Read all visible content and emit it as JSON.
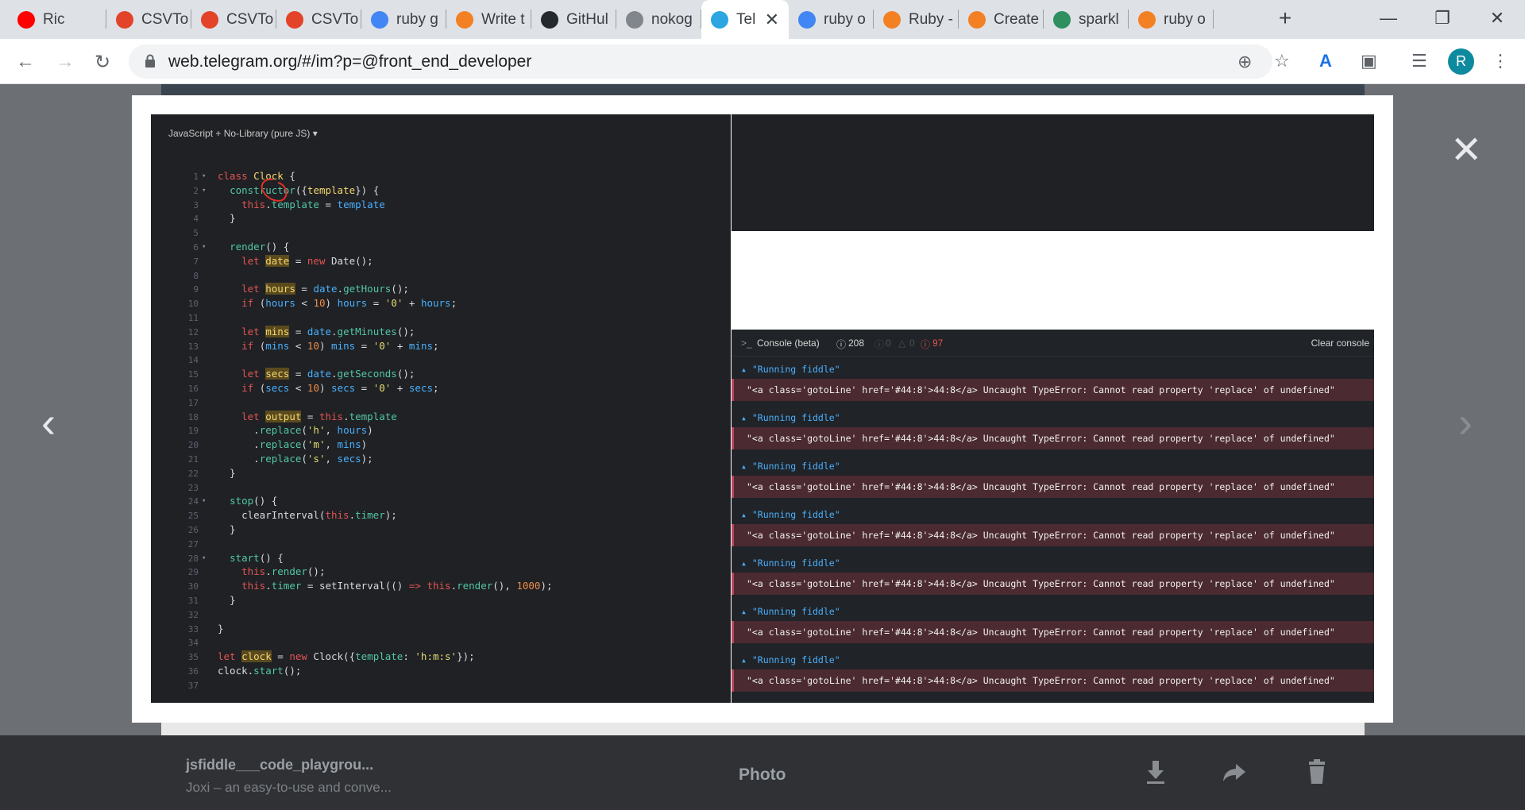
{
  "browser": {
    "tabs": [
      {
        "title": "Ric",
        "favicon": "youtube-icon",
        "color": "#ff0000",
        "active": false
      },
      {
        "title": "CSVTo",
        "favicon": "gitlab-icon",
        "color": "#e24329",
        "active": false
      },
      {
        "title": "CSVTo",
        "favicon": "gitlab-icon",
        "color": "#e24329",
        "active": false
      },
      {
        "title": "CSVTo",
        "favicon": "gitlab-icon",
        "color": "#e24329",
        "active": false
      },
      {
        "title": "ruby g",
        "favicon": "google-icon",
        "color": "#4285f4",
        "active": false
      },
      {
        "title": "Write t",
        "favicon": "stackoverflow-icon",
        "color": "#f48024",
        "active": false
      },
      {
        "title": "GitHul",
        "favicon": "github-icon",
        "color": "#24292e",
        "active": false
      },
      {
        "title": "nokog",
        "favicon": "globe-icon",
        "color": "#80868b",
        "active": false
      },
      {
        "title": "Tel",
        "favicon": "telegram-icon",
        "color": "#2ca5e0",
        "active": true
      },
      {
        "title": "ruby o",
        "favicon": "google-icon",
        "color": "#4285f4",
        "active": false
      },
      {
        "title": "Ruby -",
        "favicon": "stackoverflow-icon",
        "color": "#f48024",
        "active": false
      },
      {
        "title": "Create",
        "favicon": "stackoverflow-icon",
        "color": "#f48024",
        "active": false
      },
      {
        "title": "sparkl",
        "favicon": "owl-icon",
        "color": "#2f8f5f",
        "active": false
      },
      {
        "title": "ruby o",
        "favicon": "stackoverflow-icon",
        "color": "#f48024",
        "active": false
      }
    ],
    "url": "web.telegram.org/#/im?p=@front_end_developer",
    "profile_initial": "R"
  },
  "editor": {
    "language_label": "JavaScript + No-Library (pure JS) ▾"
  },
  "console": {
    "title": "Console (beta)",
    "log_count": "208",
    "warn_count": "0",
    "info_count": "0",
    "error_count": "97",
    "clear_label": "Clear console",
    "info_message": "\"Running fiddle\"",
    "error_message": "\"<a class='gotoLine' href='#44:8'>44:8</a> Uncaught TypeError: Cannot read property 'replace' of undefined\""
  },
  "media_viewer": {
    "file_title": "jsfiddle___code_playgrou...",
    "file_subtitle": "Joxi – an easy-to-use and conve...",
    "type_label": "Photo"
  }
}
